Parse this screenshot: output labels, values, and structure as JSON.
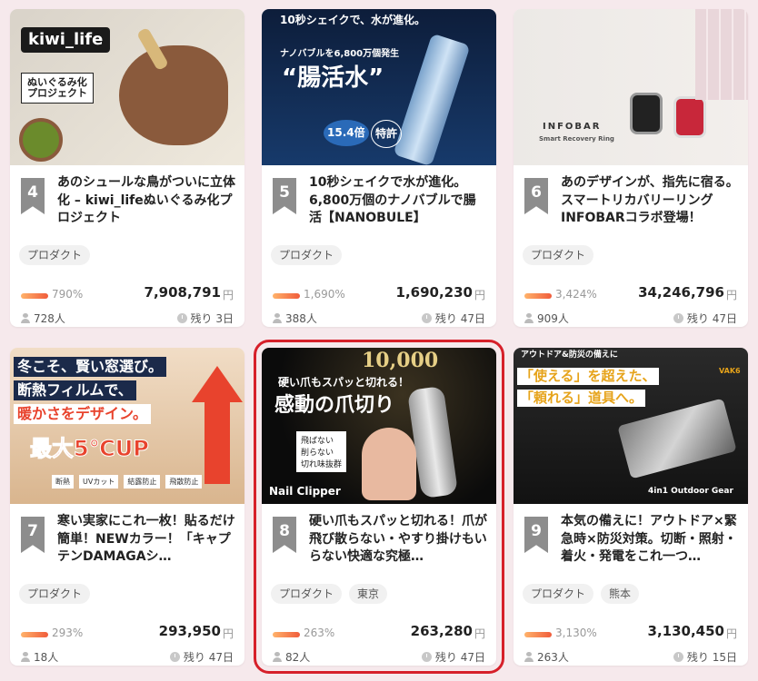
{
  "cards": [
    {
      "rank": "4",
      "title": "あのシュールな鳥がついに立体化 – kiwi_lifeぬいぐるみ化プロジェクト",
      "tags": [
        "プロダクト"
      ],
      "percent": "790%",
      "amount": "7,908,791",
      "currency": "円",
      "supporters": "728人",
      "remaining": "残り 3日",
      "image_text": {
        "logo": "kiwi_life",
        "caption": "ぬいぐるみ化\nプロジェクト"
      }
    },
    {
      "rank": "5",
      "title": "10秒シェイクで水が進化。6,800万個のナノバブルで腸活【NANOBULE】",
      "tags": [
        "プロダクト"
      ],
      "percent": "1,690%",
      "amount": "1,690,230",
      "currency": "円",
      "supporters": "388人",
      "remaining": "残り 47日",
      "image_text": {
        "headline": "10秒シェイクで、水が進化。",
        "sub": "ナノバブルを6,800万個発生",
        "main": "“腸活水”",
        "badge1": "15.4倍",
        "badge2": "特許"
      }
    },
    {
      "rank": "6",
      "title": "あのデザインが、指先に宿る。スマートリカバリーリングINFOBARコラボ登場！",
      "tags": [
        "プロダクト"
      ],
      "percent": "3,424%",
      "amount": "34,246,796",
      "currency": "円",
      "supporters": "909人",
      "remaining": "残り 47日",
      "image_text": {
        "brand": "INFOBAR",
        "sub": "Smart Recovery Ring"
      }
    },
    {
      "rank": "7",
      "title": "寒い実家にこれ一枚！貼るだけ簡単！NEWカラー！「キャプテンDAMAGAシ…",
      "tags": [
        "プロダクト"
      ],
      "percent": "293%",
      "amount": "293,950",
      "currency": "円",
      "supporters": "18人",
      "remaining": "残り 47日",
      "image_text": {
        "line1": "冬こそ、賢い窓選び。",
        "line2": "断熱フィルムで、",
        "line3": "暖かさをデザイン。",
        "big": "最大5℃UP",
        "chips": [
          "断熱",
          "UVカット",
          "結露防止",
          "飛散防止"
        ]
      }
    },
    {
      "rank": "8",
      "title": "硬い爪もスパッと切れる！爪が飛び散らない・やすり掛けもいらない快適な究極…",
      "tags": [
        "プロダクト",
        "東京"
      ],
      "percent": "263%",
      "amount": "263,280",
      "currency": "円",
      "supporters": "82人",
      "remaining": "残り 47日",
      "image_text": {
        "top": "10,000",
        "line1": "硬い爪もスパッと切れる！",
        "line2": "感動の爪切り",
        "checks": [
          "飛ばない",
          "削らない",
          "切れ味抜群"
        ],
        "footer": "Nail Clipper"
      }
    },
    {
      "rank": "9",
      "title": "本気の備えに！アウトドア×緊急時×防災対策。切断・照射・着火・発電をこれ一つ…",
      "tags": [
        "プロダクト",
        "熊本"
      ],
      "percent": "3,130%",
      "amount": "3,130,450",
      "currency": "円",
      "supporters": "263人",
      "remaining": "残り 15日",
      "image_text": {
        "top": "アウトドア&防災の備えに",
        "line1": "「使える」を超えた、",
        "line2": "「頼れる」道具へ。",
        "brand": "VAK6",
        "footer": "4in1 Outdoor Gear"
      }
    }
  ]
}
